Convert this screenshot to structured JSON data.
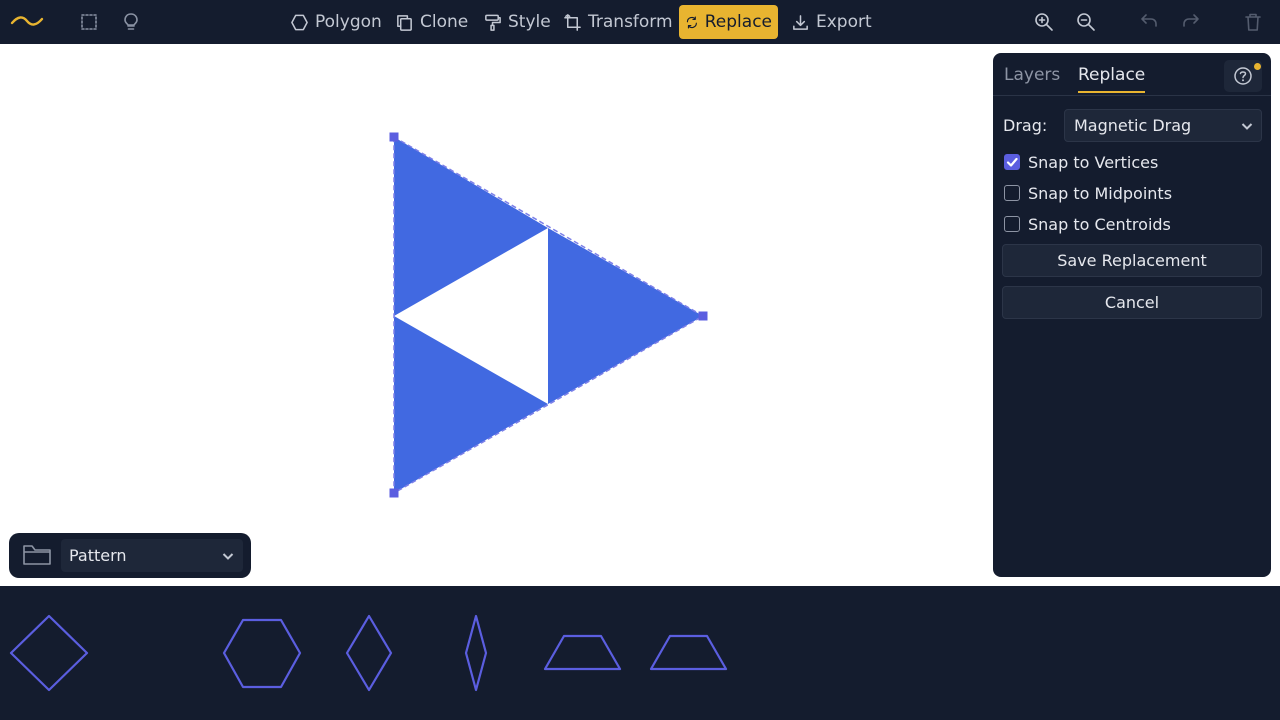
{
  "toolbar": {
    "tools": [
      {
        "name": "polygon",
        "label": "Polygon",
        "icon": "hexagon-icon"
      },
      {
        "name": "clone",
        "label": "Clone",
        "icon": "copy-icon"
      },
      {
        "name": "style",
        "label": "Style",
        "icon": "paint-roller-icon"
      },
      {
        "name": "transform",
        "label": "Transform",
        "icon": "transform-icon"
      },
      {
        "name": "replace",
        "label": "Replace",
        "icon": "replace-icon",
        "active": true
      },
      {
        "name": "export",
        "label": "Export",
        "icon": "download-icon"
      }
    ],
    "icons": [
      "logo-icon",
      "select-icon",
      "lightbulb-icon",
      "zoom-in-icon",
      "zoom-out-icon",
      "undo-icon",
      "redo-icon",
      "trash-icon"
    ]
  },
  "panel": {
    "tabs": [
      {
        "label": "Layers",
        "active": false
      },
      {
        "label": "Replace",
        "active": true
      }
    ],
    "help_icon": "help-icon",
    "drag_label": "Drag:",
    "drag_value": "Magnetic Drag",
    "options": [
      {
        "label": "Snap to Vertices",
        "checked": true
      },
      {
        "label": "Snap to Midpoints",
        "checked": false
      },
      {
        "label": "Snap to Centroids",
        "checked": false
      }
    ],
    "save_label": "Save Replacement",
    "cancel_label": "Cancel"
  },
  "pattern": {
    "folder_icon": "folder-icon",
    "value": "Pattern"
  },
  "palette": {
    "shapes": [
      "square",
      "hexagon",
      "wide-rhombus",
      "narrow-rhombus",
      "trapezoid",
      "trapezoid"
    ]
  },
  "colors": {
    "chrome": "#141c2e",
    "accent": "#e8b430",
    "shape_fill": "#4169e1",
    "outline": "#5b5ee0"
  }
}
